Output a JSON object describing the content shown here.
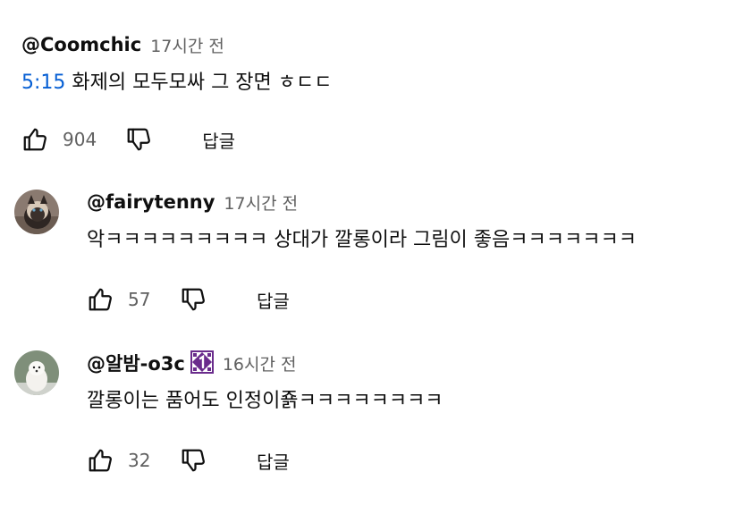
{
  "comments": [
    {
      "author": "@Coomchic",
      "time": "17시간 전",
      "timestamp_link": "5:15",
      "text": " 화제의 모두모싸 그 장면 ㅎㄷㄷ",
      "likes": "904",
      "reply_label": "답글"
    },
    {
      "author": "@fairytenny",
      "time": "17시간 전",
      "text": "악ㅋㅋㅋㅋㅋㅋㅋㅋㅋ 상대가 깔롱이라 그림이 좋음ㅋㅋㅋㅋㅋㅋㅋ",
      "likes": "57",
      "reply_label": "답글"
    },
    {
      "author": "@알밤-o3c",
      "time": "16시간 전",
      "text": "깔롱이는 품어도 인정이죩ㅋㅋㅋㅋㅋㅋㅋㅋ",
      "likes": "32",
      "reply_label": "답글"
    }
  ],
  "icons": {
    "like": "thumb-up-icon",
    "dislike": "thumb-down-icon",
    "member_badge": "member-badge-icon"
  },
  "colors": {
    "timestamp_link": "#065fd4",
    "meta_text": "#606060"
  }
}
